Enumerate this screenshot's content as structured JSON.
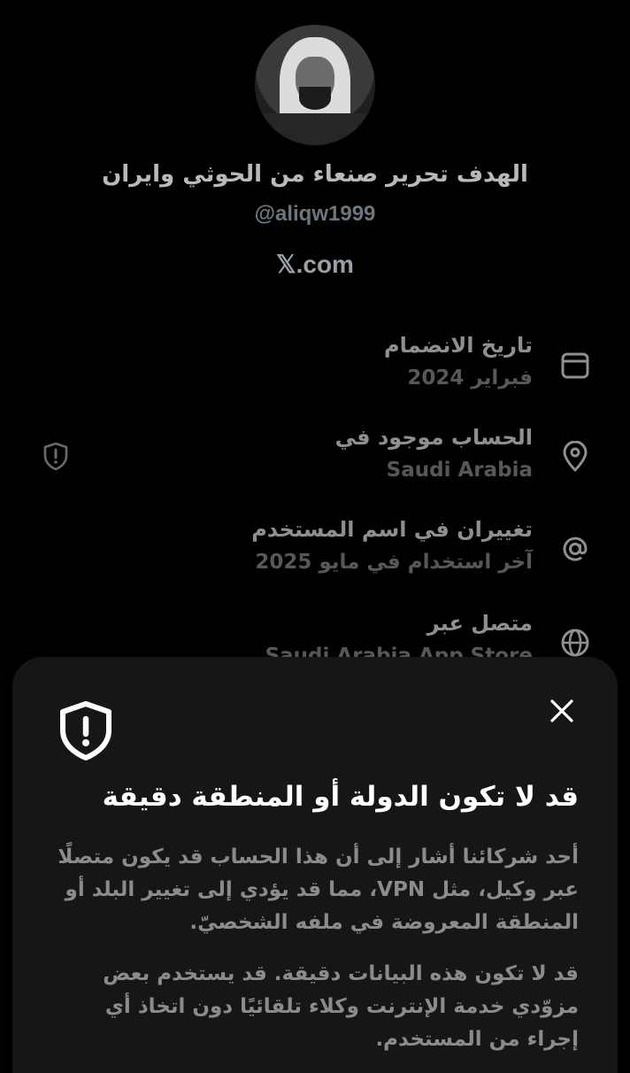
{
  "profile": {
    "display_name": "الهدف تحرير صنعاء من الحوثي وايران",
    "handle": "@aliqw1999",
    "site": "𝕏.com"
  },
  "about": {
    "joined": {
      "title": "تاريخ الانضمام",
      "value": "فبراير 2024",
      "icon": "calendar-icon"
    },
    "location": {
      "title": "الحساب موجود في",
      "value": "Saudi Arabia",
      "icon": "location-pin-icon",
      "side_icon": "shield-alert-icon"
    },
    "username_changes": {
      "title": "تغييران في اسم المستخدم",
      "value": "آخر استخدام في مايو 2025",
      "icon": "at-sign-icon"
    },
    "connected_via": {
      "title": "متصل عبر",
      "value": "Saudi Arabia App Store",
      "icon": "globe-icon"
    }
  },
  "sheet": {
    "title": "قد لا تكون الدولة أو المنطقة دقيقة",
    "paragraph1": "أحد شركائنا أشار إلى أن هذا الحساب قد يكون متصلًا عبر وكيل، مثل VPN، مما قد يؤدي إلى تغيير البلد أو المنطقة المعروضة في ملفه الشخصيّ.",
    "paragraph2": "قد لا تكون هذه البيانات دقيقة. قد يستخدم بعض مزوّدي خدمة الإنترنت وكلاء تلقائيًا دون اتخاذ أي إجراء من المستخدم.",
    "close_icon": "close-icon",
    "shield_icon": "shield-alert-icon"
  },
  "colors": {
    "background": "#000000",
    "sheet": "#161616",
    "title_text": "#ffffff",
    "muted_text": "#8b8b8b"
  }
}
